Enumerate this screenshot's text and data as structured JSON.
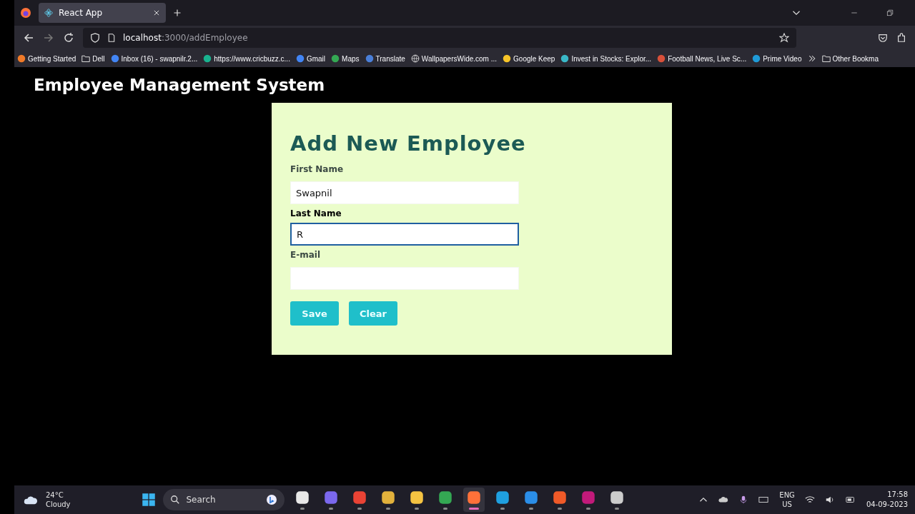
{
  "browser": {
    "tabs": [
      {
        "title": "React App",
        "selected": true
      }
    ],
    "url_host": "localhost",
    "url_path": ":3000/addEmployee",
    "bookmarks": [
      {
        "kind": "site",
        "label": "Getting Started",
        "color": "#f07a28"
      },
      {
        "kind": "folder",
        "label": "Dell"
      },
      {
        "kind": "site",
        "label": "Inbox (16) - swapnilr.2...",
        "color": "#4285f4"
      },
      {
        "kind": "site",
        "label": "https://www.cricbuzz.c...",
        "color": "#19b28f"
      },
      {
        "kind": "site",
        "label": "Gmail",
        "color": "#4285f4"
      },
      {
        "kind": "site",
        "label": "Maps",
        "color": "#34a853"
      },
      {
        "kind": "site",
        "label": "Translate",
        "color": "#4a7fd8"
      },
      {
        "kind": "globe",
        "label": "WallpapersWide.com ..."
      },
      {
        "kind": "site",
        "label": "Google Keep",
        "color": "#f7c428"
      },
      {
        "kind": "site",
        "label": "Invest in Stocks: Explor...",
        "color": "#3ab8c8"
      },
      {
        "kind": "site",
        "label": "Football News, Live Sc...",
        "color": "#d8503a"
      },
      {
        "kind": "site",
        "label": "Prime Video",
        "color": "#1f9bd8"
      }
    ],
    "other_bookmarks": "Other Bookma"
  },
  "page": {
    "app_title": "Employee Management System",
    "form_title": "Add New Employee",
    "fields": [
      {
        "label": "First Name",
        "value": "Swapnil",
        "focused": false
      },
      {
        "label": "Last Name",
        "value": "R",
        "focused": true
      },
      {
        "label": "E-mail",
        "focused": false
      }
    ],
    "buttons": [
      "Save",
      "Clear"
    ]
  },
  "taskbar": {
    "temperature": "24°C",
    "weather": "Cloudy",
    "search_placeholder": "Search",
    "apps": [
      {
        "color": "#e8e8e8",
        "selected": false
      },
      {
        "color": "#7b68ee",
        "selected": false
      },
      {
        "color": "#ea4335",
        "selected": false
      },
      {
        "color": "#e2b13c",
        "selected": false
      },
      {
        "color": "#f5c342",
        "selected": false
      },
      {
        "color": "#34a853",
        "selected": false
      },
      {
        "color": "#ff7139",
        "selected": true
      },
      {
        "color": "#1fa0e0",
        "selected": false
      },
      {
        "color": "#2b8ee8",
        "selected": false
      },
      {
        "color": "#f05a28",
        "selected": false
      },
      {
        "color": "#c21a7a",
        "selected": false
      },
      {
        "color": "#cccccc",
        "selected": false
      }
    ],
    "language": "ENG",
    "region": "US",
    "time": "17:58",
    "date": "04-09-2023"
  }
}
